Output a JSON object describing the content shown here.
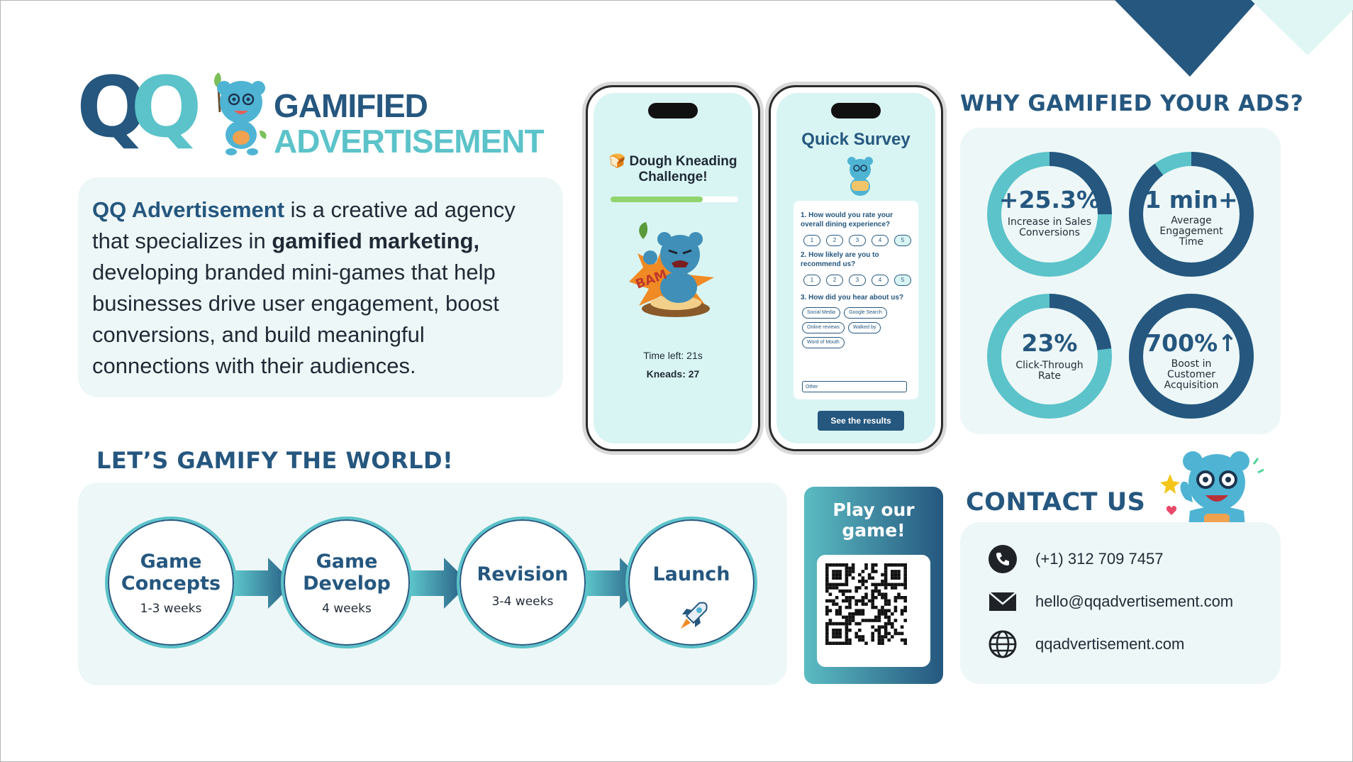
{
  "logo": {
    "mark_q1": "Q",
    "mark_q2": "Q",
    "title_line1": "GAMIFIED",
    "title_line2": "ADVERTISEMENT"
  },
  "intro": {
    "brand": "QQ Advertisement",
    "text_a": " is a creative ad agency that specializes in ",
    "highlight": "gamified marketing,",
    "text_b": " developing branded mini-games that help businesses drive user engagement, boost conversions, and build meaningful connections with their audiences."
  },
  "phone1": {
    "title_icon": "🍞",
    "title": "Dough Kneading Challenge!",
    "progress": 0.72,
    "bam": "BAM",
    "time_left": "Time left: 21s",
    "kneads": "Kneads: 27"
  },
  "phone2": {
    "title": "Quick Survey",
    "q1": "1. How would you rate your overall dining experience?",
    "q2": "2. How likely are you to recommend us?",
    "q3": "3. How did you hear about us?",
    "ratings": [
      "1",
      "2",
      "3",
      "4",
      "5"
    ],
    "chips": [
      "Social Media",
      "Google Search",
      "Online reviews",
      "Walked by",
      "Word of Mouth"
    ],
    "other_placeholder": "Other",
    "button": "See the results"
  },
  "why": {
    "title": "WHY GAMIFIED YOUR ADS?",
    "stats": [
      {
        "value": "+25.3%",
        "label": "Increase in Sales Conversions",
        "fill": 0.25
      },
      {
        "value": "1 min+",
        "label": "Average Engagement Time",
        "fill": 0.9
      },
      {
        "value": "23%",
        "label": "Click-Through Rate",
        "fill": 0.23
      },
      {
        "value": "700%↑",
        "label": "Boost in Customer Acquisition",
        "fill": 1.0
      }
    ]
  },
  "gamify": {
    "title": "LET’S GAMIFY THE WORLD!",
    "steps": [
      {
        "name": "Game Concepts",
        "line1": "Game",
        "line2": "Concepts",
        "duration": "1-3 weeks"
      },
      {
        "name": "Game Develop",
        "line1": "Game",
        "line2": "Develop",
        "duration": "4 weeks"
      },
      {
        "name": "Revision",
        "line1": "Revision",
        "duration": "3-4 weeks"
      },
      {
        "name": "Launch",
        "line1": "Launch",
        "icon": "rocket-icon"
      }
    ]
  },
  "qr": {
    "line1": "Play our",
    "line2": "game!"
  },
  "contact": {
    "title": "CONTACT US",
    "phone": "(+1) 312 709 7457",
    "email": "hello@qqadvertisement.com",
    "website": "qqadvertisement.com"
  },
  "colors": {
    "navy": "#25577f",
    "teal": "#5bc3c9",
    "panel": "#eef7f7",
    "mint": "#d9f5f3"
  }
}
